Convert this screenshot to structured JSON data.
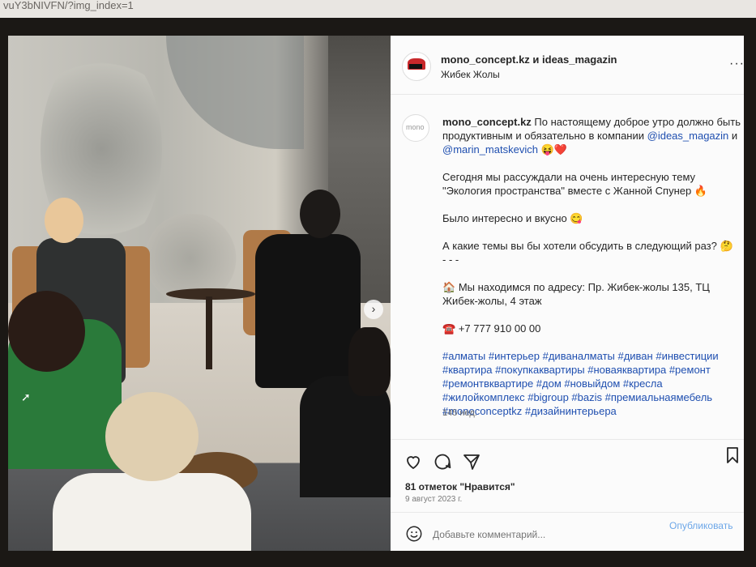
{
  "browser": {
    "url_fragment": "vuY3bNIVFN/?img_index=1"
  },
  "post": {
    "owner": "mono_concept.kz и ideas_magazin",
    "location": "Жибек Жолы",
    "caption": {
      "username": "mono_concept.kz",
      "line1": "По настоящему доброе утро должно быть продуктивным и обязательно в компании",
      "mention1": "@ideas_magazin",
      "and": "и",
      "mention2": "@marin_matskevich",
      "emoji1": "😝❤️",
      "para2": "Сегодня мы рассуждали на очень интересную тему \"Экология пространства\" вместе с Жанной Спунер",
      "emoji2": "🔥",
      "para3": "Было интересно и вкусно",
      "emoji3": "😋",
      "para4": "А какие темы вы бы хотели обсудить в следующий раз?",
      "emoji4": "🤔",
      "dashes": "- - -",
      "address_emoji": "🏠",
      "address": "Мы находимся по адресу: Пр. Жибек-жолы 135, ТЦ Жибек-жолы, 4 этаж",
      "phone_emoji": "☎️",
      "phone": "+7 777 910 00 00",
      "hashtags": "#алматы #интерьер #диваналматы #диван #инвестиции #квартира #покупкаквартиры #новаяквартира #ремонт #ремонтвквартире #дом #новыйдом #кресла #жилойкомплекс #bigroup #bazis #премиальнаямебель #monoconceptkz #дизайнинтерьера"
    },
    "time_ago": "145 нед.",
    "likes": "81 отметок \"Нравится\"",
    "date": "9 август 2023 г.",
    "comment_placeholder": "Добавьте комментарий...",
    "publish_label": "Опубликовать",
    "avatar_text": "mono"
  },
  "icons": {
    "like": "heart-outline-icon",
    "comment": "comment-bubble-icon",
    "share": "paper-plane-icon",
    "save": "bookmark-icon",
    "emoji": "smiley-icon",
    "more": "more-horizontal-icon",
    "next": "chevron-right-icon"
  },
  "colors": {
    "link": "#1f4fb0",
    "publish": "#6da7e8",
    "brand_red": "#c8282b"
  }
}
